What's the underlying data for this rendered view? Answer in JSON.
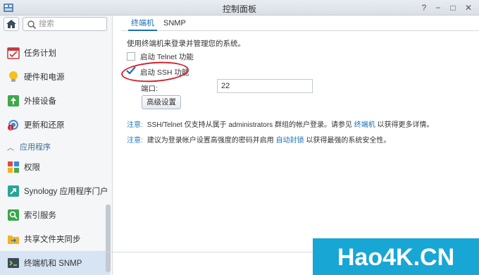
{
  "window": {
    "title": "控制面板"
  },
  "sidebar": {
    "search_placeholder": "搜索",
    "items": [
      {
        "label": "任务计划",
        "icon": "task-scheduler-icon"
      },
      {
        "label": "硬件和电源",
        "icon": "lightbulb-icon"
      },
      {
        "label": "外接设备",
        "icon": "external-device-icon"
      },
      {
        "label": "更新和还原",
        "icon": "update-restore-icon"
      }
    ],
    "section": {
      "label": "应用程序"
    },
    "app_items": [
      {
        "label": "权限",
        "icon": "privileges-icon"
      },
      {
        "label": "Synology 应用程序门户",
        "icon": "app-portal-icon"
      },
      {
        "label": "索引服务",
        "icon": "indexing-service-icon"
      },
      {
        "label": "共享文件夹同步",
        "icon": "folder-sync-icon"
      },
      {
        "label": "终端机和 SNMP",
        "icon": "terminal-snmp-icon",
        "active": true
      }
    ]
  },
  "tabs": [
    {
      "label": "终端机",
      "active": true
    },
    {
      "label": "SNMP",
      "active": false
    }
  ],
  "terminal": {
    "description": "使用终端机来登录并管理您的系统。",
    "telnet": {
      "label": "启动 Telnet 功能",
      "checked": false
    },
    "ssh": {
      "label": "启动 SSH 功能",
      "checked": true
    },
    "port_label": "端口:",
    "port_value": "22",
    "advanced_button": "高级设置",
    "notes": [
      {
        "tag": "注意:",
        "text_before": "SSH/Telnet 仅支持从属于 administrators 群组的帐户登录。请参见",
        "link": "终端机",
        "text_after": "以获得更多详情。"
      },
      {
        "tag": "注意:",
        "text_before": "建议为登录帐户设置高强度的密码并启用",
        "link": "自动封锁",
        "text_after": "以获得最强的系统安全性。"
      }
    ]
  },
  "watermark": {
    "text": "Hao4K.CN"
  },
  "colors": {
    "accent": "#1a6eb5",
    "annotation_red": "#d3222a",
    "watermark_bg": "#18a6d4"
  }
}
